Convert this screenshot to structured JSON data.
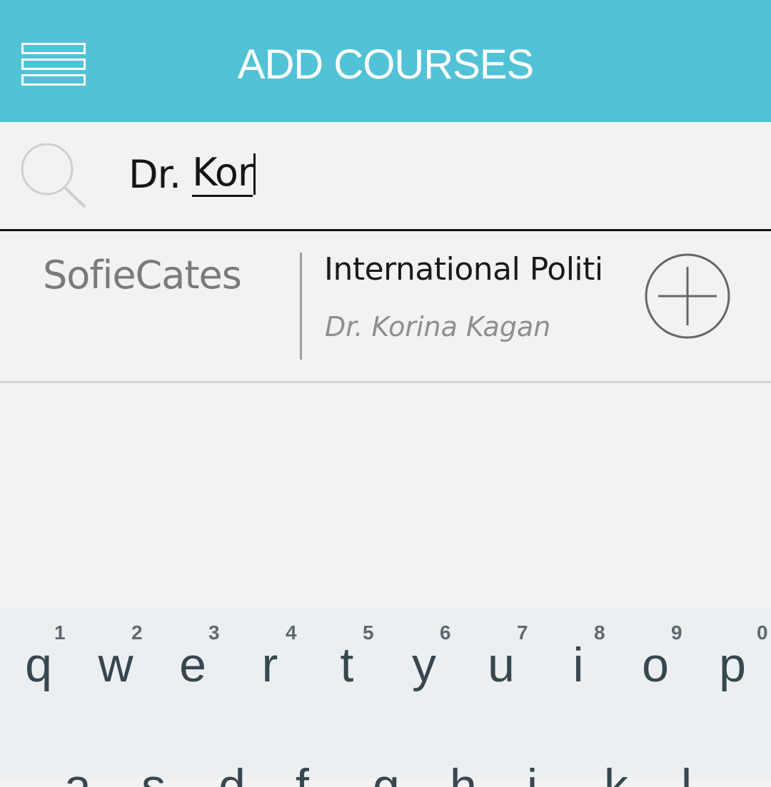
{
  "header": {
    "title": "ADD COURSES",
    "background_color": "#52c2d6",
    "menu_icon": "hamburger-menu-icon"
  },
  "search": {
    "icon": "search-icon",
    "typed_text": "Dr. ",
    "composing_text": "Kor"
  },
  "results": [
    {
      "author": "SofieCates",
      "course_title": "International Politi",
      "teacher": "Dr. Korina Kagan",
      "action_icon": "add-circle-icon"
    }
  ],
  "keyboard": {
    "row1": [
      {
        "letter": "q",
        "hint": "1"
      },
      {
        "letter": "w",
        "hint": "2"
      },
      {
        "letter": "e",
        "hint": "3"
      },
      {
        "letter": "r",
        "hint": "4"
      },
      {
        "letter": "t",
        "hint": "5"
      },
      {
        "letter": "y",
        "hint": "6"
      },
      {
        "letter": "u",
        "hint": "7"
      },
      {
        "letter": "i",
        "hint": "8"
      },
      {
        "letter": "o",
        "hint": "9"
      },
      {
        "letter": "p",
        "hint": "0"
      }
    ],
    "row2": [
      "a",
      "s",
      "d",
      "f",
      "g",
      "h",
      "j",
      "k",
      "l"
    ]
  }
}
